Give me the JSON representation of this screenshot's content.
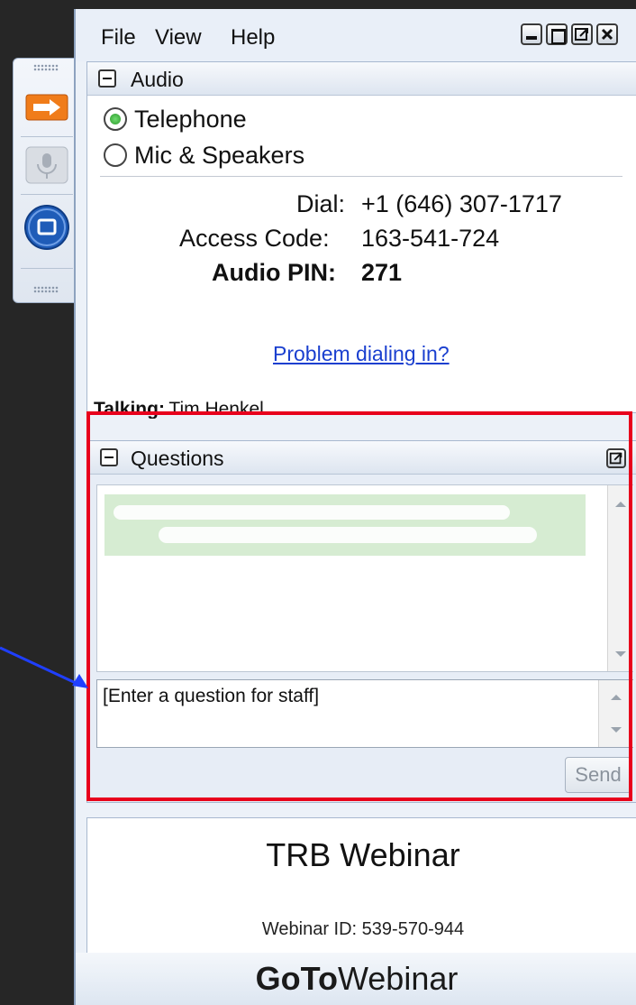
{
  "menu": {
    "file": "File",
    "view": "View",
    "help": "Help"
  },
  "audio": {
    "title": "Audio",
    "telephone": "Telephone",
    "mic_speakers": "Mic & Speakers",
    "dial_label": "Dial:",
    "dial_value": "+1 (646) 307-1717",
    "access_label": "Access Code:",
    "access_value": "163-541-724",
    "pin_label": "Audio PIN:",
    "pin_value": "271",
    "problem_link": "Problem dialing in?"
  },
  "talking": {
    "label": "Talking:",
    "name": "Tim Henkel"
  },
  "questions": {
    "title": "Questions",
    "placeholder": "[Enter a question for staff]",
    "send": "Send"
  },
  "footer": {
    "webinar_name": "TRB Webinar",
    "webinar_id": "Webinar ID: 539-570-944",
    "brand_goto": "GoTo",
    "brand_webinar": "Webinar"
  },
  "colors": {
    "highlight_box": "#e8001c",
    "pointer_arrow": "#1f3fff",
    "link": "#1a3fcf"
  }
}
